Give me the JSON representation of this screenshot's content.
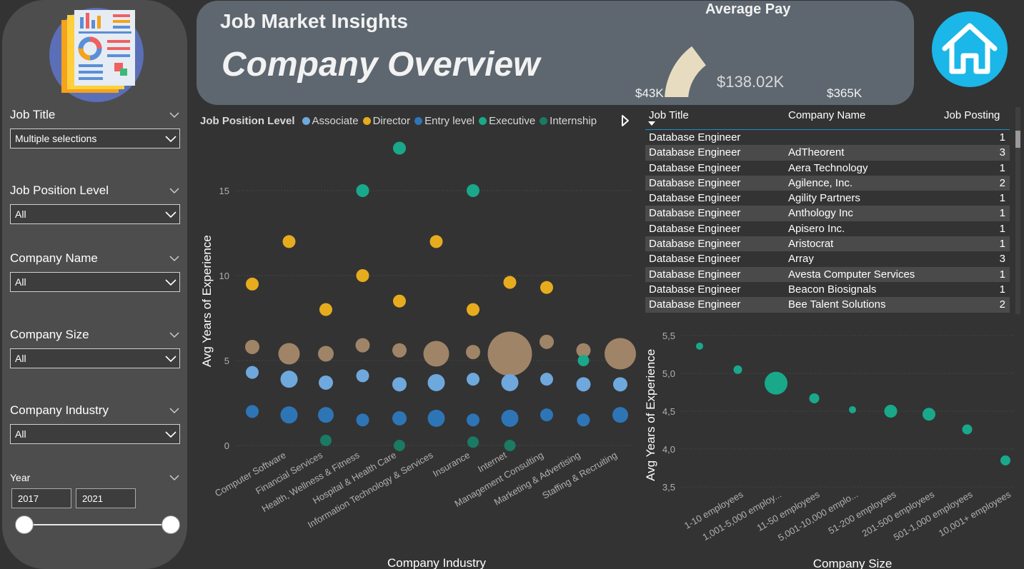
{
  "header": {
    "app_title": "Job Market Insights",
    "page_title": "Company Overview",
    "gauge": {
      "title": "Average Pay",
      "min": "$43K",
      "max": "$365K",
      "value": "$138.02K",
      "fraction": 0.2957,
      "fill_color": "#e8dcc0"
    }
  },
  "sidebar": {
    "logo_icon": "report-document-icon",
    "slicers": [
      {
        "title": "Job Title",
        "value": "Multiple selections"
      },
      {
        "title": "Job Position Level",
        "value": "All"
      },
      {
        "title": "Company Name",
        "value": "All"
      },
      {
        "title": "Company Size",
        "value": "All"
      },
      {
        "title": "Company Industry",
        "value": "All"
      }
    ],
    "year": {
      "title": "Year",
      "from": "2017",
      "to": "2021"
    }
  },
  "home_icon": "home-icon",
  "legend": {
    "title": "Job Position Level",
    "items": [
      {
        "label": "Associate",
        "color": "#6fa8dc"
      },
      {
        "label": "Director",
        "color": "#e6ac1e"
      },
      {
        "label": "Entry level",
        "color": "#2e75b6"
      },
      {
        "label": "Executive",
        "color": "#19a88a"
      },
      {
        "label": "Internship",
        "color": "#1a7a63"
      }
    ]
  },
  "table": {
    "headers": [
      "Job Title",
      "Company Name",
      "Job Posting"
    ],
    "rows": [
      [
        "Database Engineer",
        "",
        "1"
      ],
      [
        "Database Engineer",
        "AdTheorent",
        "3"
      ],
      [
        "Database Engineer",
        "Aera Technology",
        "1"
      ],
      [
        "Database Engineer",
        "Agilence, Inc.",
        "2"
      ],
      [
        "Database Engineer",
        "Agility Partners",
        "1"
      ],
      [
        "Database Engineer",
        "Anthology Inc",
        "1"
      ],
      [
        "Database Engineer",
        "Apisero Inc.",
        "1"
      ],
      [
        "Database Engineer",
        "Aristocrat",
        "1"
      ],
      [
        "Database Engineer",
        "Array",
        "3"
      ],
      [
        "Database Engineer",
        "Avesta Computer Services",
        "1"
      ],
      [
        "Database Engineer",
        "Beacon Biosignals",
        "1"
      ],
      [
        "Database Engineer",
        "Bee Talent Solutions",
        "2"
      ]
    ]
  },
  "chart_data": [
    {
      "type": "scatter",
      "xlabel": "Company Industry",
      "ylabel": "Avg Years of Experience",
      "ylim": [
        0,
        17.6
      ],
      "yticks": [
        "0",
        "5",
        "10",
        "15"
      ],
      "grid": true,
      "categories": [
        "Computer Software",
        "Financial Services",
        "Health, Wellness & Fitness",
        "Hospital & Health Care",
        "Information Technology & Services",
        "Insurance",
        "Internet",
        "Management Consulting",
        "Marketing & Advertising",
        "Staffing & Recruiting"
      ],
      "series": [
        {
          "name": "Internship",
          "color": "#1a7a63",
          "points": [
            [
              2,
              0.3,
              8
            ],
            [
              4,
              0,
              8
            ],
            [
              6,
              0.2,
              8
            ],
            [
              7,
              0,
              8
            ]
          ]
        },
        {
          "name": "Entry level",
          "color": "#2e75b6",
          "points": [
            [
              0,
              2.0,
              9
            ],
            [
              1,
              1.8,
              12
            ],
            [
              2,
              1.8,
              11
            ],
            [
              3,
              1.5,
              9
            ],
            [
              4,
              1.6,
              10
            ],
            [
              5,
              1.6,
              12
            ],
            [
              6,
              1.5,
              9
            ],
            [
              7,
              1.6,
              12
            ],
            [
              8,
              1.8,
              9
            ],
            [
              9,
              1.5,
              9
            ],
            [
              10,
              1.8,
              11
            ]
          ]
        },
        {
          "name": "Associate",
          "color": "#6fa8dc",
          "points": [
            [
              0,
              4.3,
              9
            ],
            [
              1,
              3.9,
              12
            ],
            [
              2,
              3.7,
              10
            ],
            [
              3,
              4.1,
              9
            ],
            [
              4,
              3.6,
              10
            ],
            [
              5,
              3.7,
              12
            ],
            [
              6,
              3.9,
              9
            ],
            [
              7,
              3.7,
              12
            ],
            [
              8,
              3.9,
              9
            ],
            [
              9,
              3.6,
              10
            ],
            [
              10,
              3.6,
              10
            ]
          ]
        },
        {
          "name": "Director",
          "color": "#e6ac1e",
          "points": [
            [
              0,
              9.5,
              9
            ],
            [
              1,
              12.0,
              9
            ],
            [
              2,
              8.0,
              9
            ],
            [
              3,
              10.0,
              9
            ],
            [
              4,
              8.5,
              9
            ],
            [
              5,
              12.0,
              9
            ],
            [
              6,
              8.0,
              9
            ],
            [
              7,
              9.6,
              9
            ],
            [
              8,
              9.3,
              9
            ]
          ]
        },
        {
          "name": "Executive",
          "color": "#19a88a",
          "points": [
            [
              3,
              15.0,
              9
            ],
            [
              4,
              17.5,
              9
            ],
            [
              6,
              15.0,
              9
            ],
            [
              9,
              5.0,
              8
            ]
          ]
        }
      ],
      "aggregate": {
        "name": "",
        "color": "#a08468",
        "points": [
          [
            0,
            5.8,
            10
          ],
          [
            1,
            5.4,
            15
          ],
          [
            2,
            5.4,
            11
          ],
          [
            3,
            5.9,
            10
          ],
          [
            4,
            5.6,
            10
          ],
          [
            5,
            5.4,
            18
          ],
          [
            6,
            5.5,
            10
          ],
          [
            7,
            5.4,
            31
          ],
          [
            8,
            6.1,
            10
          ],
          [
            9,
            5.6,
            10
          ],
          [
            10,
            5.4,
            22
          ]
        ]
      }
    },
    {
      "type": "scatter",
      "xlabel": "Company Size",
      "ylabel": "Avg Years of Experience",
      "ylim": [
        3.3,
        5.6
      ],
      "yticks": [
        "3,5",
        "4,0",
        "4,5",
        "5,0",
        "5,5"
      ],
      "grid": true,
      "categories": [
        "1-10 employees",
        "1,001-5,000 employ...",
        "11-50 employees",
        "5,001-10,000 emplo...",
        "51-200 employees",
        "201-500 employees",
        "501-1,000 employees",
        "10,001+ employees"
      ],
      "color": "#19a88a",
      "points": [
        [
          0,
          5.36,
          5
        ],
        [
          1,
          5.05,
          6
        ],
        [
          2,
          4.87,
          16
        ],
        [
          3,
          4.67,
          7
        ],
        [
          4,
          4.52,
          5
        ],
        [
          5,
          4.5,
          9
        ],
        [
          6,
          4.46,
          9
        ],
        [
          7,
          4.26,
          7
        ],
        [
          8,
          3.85,
          7
        ]
      ]
    }
  ]
}
